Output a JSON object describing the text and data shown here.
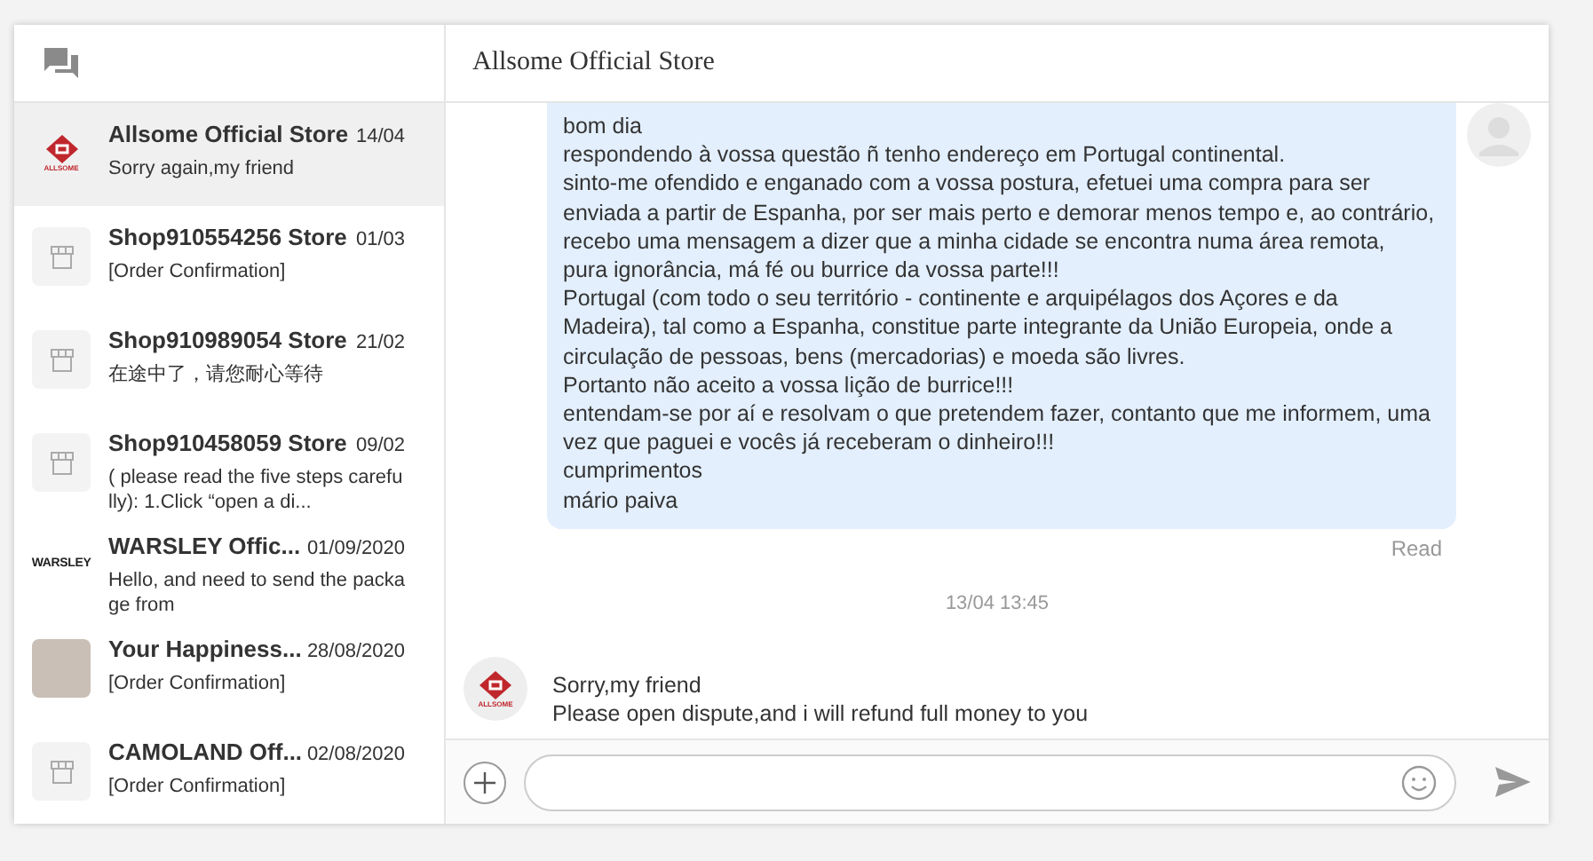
{
  "conversations": [
    {
      "name": "Allsome Official Store",
      "date": "14/04",
      "preview": "Sorry again,my friend",
      "avatar": {
        "kind": "allsome",
        "logo_text": "ALLSOME"
      },
      "selected": true
    },
    {
      "name": "Shop910554256 Store",
      "date": "01/03",
      "preview": "[Order Confirmation]",
      "avatar": {
        "kind": "shop"
      },
      "selected": false
    },
    {
      "name": "Shop910989054 Store",
      "date": "21/02",
      "preview": "在途中了，请您耐心等待",
      "avatar": {
        "kind": "shop"
      },
      "selected": false
    },
    {
      "name": "Shop910458059 Store",
      "date": "09/02",
      "preview": "( please read the five steps carefully): 1.Click “open a di...",
      "avatar": {
        "kind": "shop"
      },
      "selected": false
    },
    {
      "name": "WARSLEY Offic...",
      "date": "01/09/2020",
      "preview": "Hello, and need to send the package from",
      "avatar": {
        "kind": "wordmark",
        "logo_text": "WARSLEY"
      },
      "selected": false
    },
    {
      "name": "Your Happiness...",
      "date": "28/08/2020",
      "preview": "[Order Confirmation]",
      "avatar": {
        "kind": "photo"
      },
      "selected": false
    },
    {
      "name": "CAMOLAND Off...",
      "date": "02/08/2020",
      "preview": "[Order Confirmation]",
      "avatar": {
        "kind": "shop"
      },
      "selected": false
    }
  ],
  "chat": {
    "title": "Allsome Official Store",
    "messages": [
      {
        "kind": "outgoing",
        "text": "bom dia\nrespondendo à vossa questão ñ tenho endereço em Portugal continental.\nsinto-me ofendido e enganado com a vossa postura, efetuei uma compra para ser\nenviada a partir de Espanha, por ser mais perto e demorar menos tempo e, ao contrário,\nrecebo uma mensagem a dizer que a minha cidade se encontra numa área remota,\npura ignorância, má fé ou burrice da vossa parte!!!\nPortugal (com todo o seu território - continente e arquipélagos dos Açores e da\nMadeira), tal como a Espanha, constitue parte integrante da União Europeia, onde a\ncirculação de pessoas, bens (mercadorias) e moeda são livres.\nPortanto não aceito a vossa lição de burrice!!!\nentendam-se por aí e resolvam o que pretendem fazer, contanto que me informem, uma\nvez que paguei e vocês já receberam o dinheiro!!!\ncumprimentos\nmário paiva",
        "status": "Read"
      },
      {
        "kind": "time",
        "text": "13/04 13:45"
      },
      {
        "kind": "incoming",
        "text": "Sorry,my friend\nPlease open dispute,and i will refund full money to you",
        "logo_text": "ALLSOME"
      }
    ]
  }
}
